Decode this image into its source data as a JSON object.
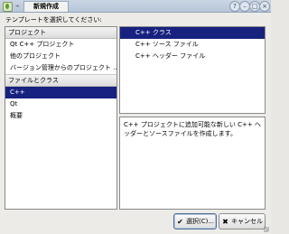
{
  "window": {
    "title": "新規作成",
    "controls": [
      "?",
      "–",
      "□",
      "×"
    ]
  },
  "instruction": "テンプレートを選択してください:",
  "categories": [
    {
      "header": "プロジェクト",
      "items": [
        {
          "label": "Qt C++ プロジェクト",
          "selected": false
        },
        {
          "label": "他のプロジェクト",
          "selected": false
        },
        {
          "label": "バージョン管理からのプロジェクト ...",
          "selected": false
        }
      ]
    },
    {
      "header": "ファイルとクラス",
      "items": [
        {
          "label": "C++",
          "selected": true
        },
        {
          "label": "Qt",
          "selected": false
        },
        {
          "label": "概要",
          "selected": false
        }
      ]
    }
  ],
  "templates": [
    {
      "label": "C++ クラス",
      "selected": true
    },
    {
      "label": "C++ ソース ファイル",
      "selected": false
    },
    {
      "label": "C++ ヘッダー ファイル",
      "selected": false
    }
  ],
  "description": "C++ プロジェクトに追加可能な新しい C++ ヘッダーとソースファイルを作成します。",
  "buttons": {
    "choose": "選択(C)...",
    "cancel": "キャンセル"
  },
  "colors": {
    "selection": "#17217f",
    "titlebar": "#b7c6d9"
  }
}
